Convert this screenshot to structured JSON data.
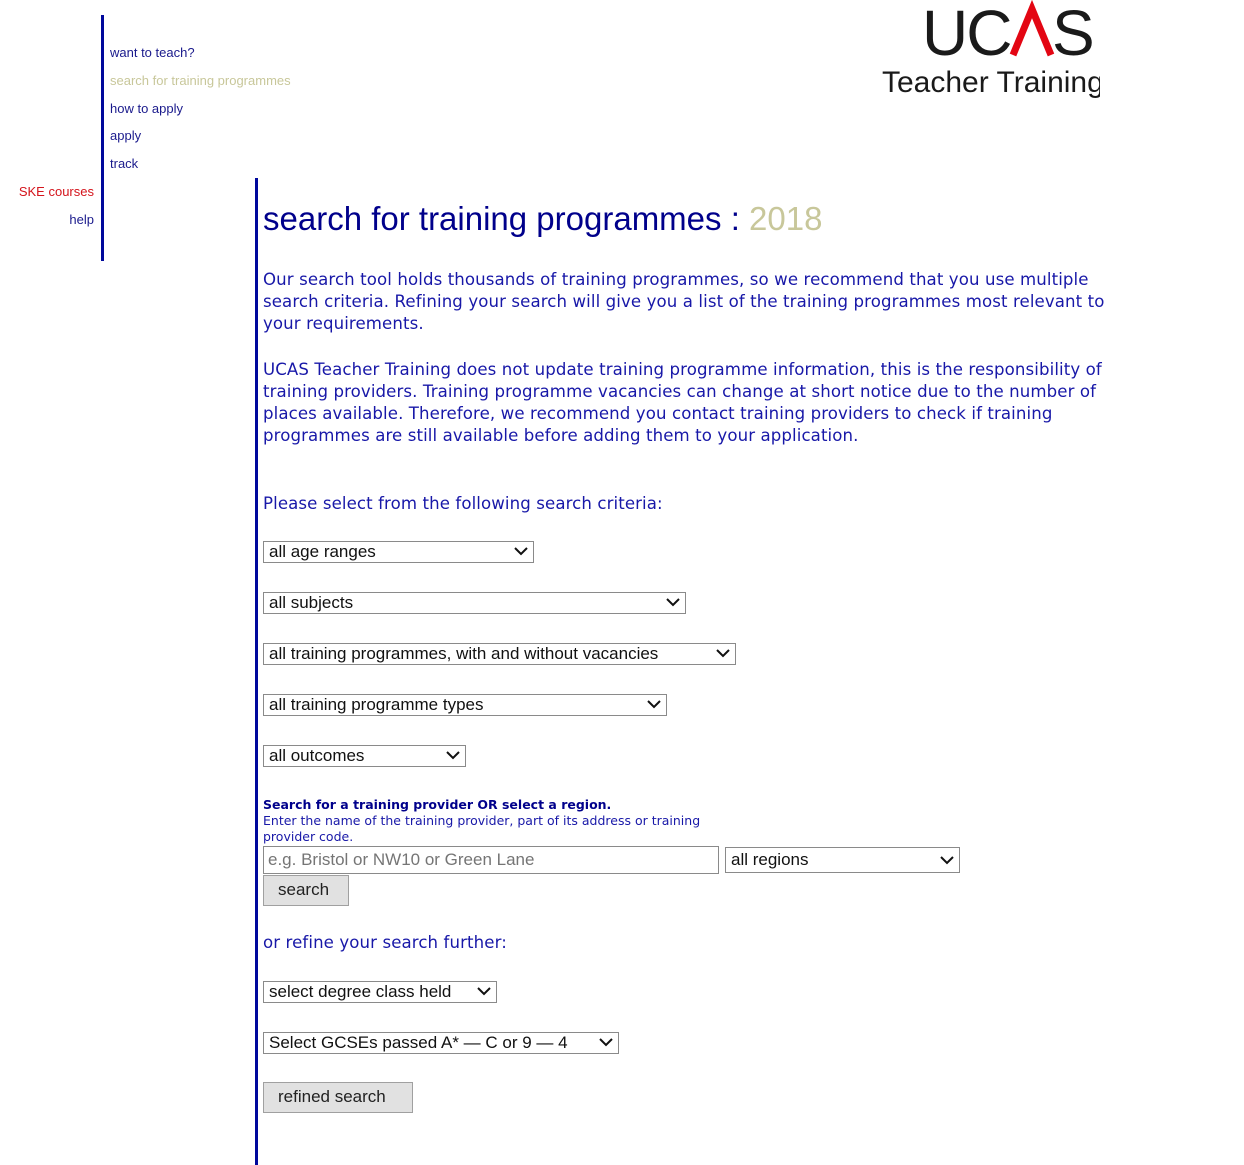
{
  "nav": {
    "items": [
      {
        "label": "want to teach?"
      },
      {
        "label": "search for training programmes",
        "active": true
      },
      {
        "label": "how to apply"
      },
      {
        "label": "apply"
      },
      {
        "label": "track"
      }
    ],
    "secondary": [
      {
        "label": "SKE courses",
        "color": "#d4141c"
      },
      {
        "label": "help",
        "color": "#1a1a8c"
      }
    ]
  },
  "logo": {
    "brand": "UCAS",
    "subtitle": "Teacher Training",
    "accent": "#e30613"
  },
  "page": {
    "title": "search for training programmes",
    "separator": " : ",
    "year": "2018",
    "intro1": "Our search tool holds thousands of training programmes, so we recommend that you use multiple search criteria. Refining your search will give you a list of the training programmes most relevant to your requirements.",
    "intro2": "UCAS Teacher Training does not update training programme information, this is the responsibility of training providers. Training programme vacancies can change at short notice due to the number of places available. Therefore, we recommend you contact training providers to check if training programmes are still available before adding them to your application.",
    "criteria_label": "Please select from the following search criteria:"
  },
  "filters": {
    "age_range": "all age ranges",
    "subject": "all subjects",
    "vacancies": "all training programmes, with and without vacancies",
    "programme_type": "all training programme types",
    "outcome": "all outcomes"
  },
  "provider_search": {
    "heading": "Search for a training provider OR select a region.",
    "help": "Enter the name of the training provider, part of its address or training provider code.",
    "placeholder": "e.g. Bristol or NW10 or Green Lane",
    "value": "",
    "region": "all regions",
    "search_label": "search"
  },
  "refine": {
    "label": "or refine your search further:",
    "degree": "select degree class held",
    "gcse": "Select GCSEs passed A* — C or 9 — 4",
    "button": "refined search"
  }
}
